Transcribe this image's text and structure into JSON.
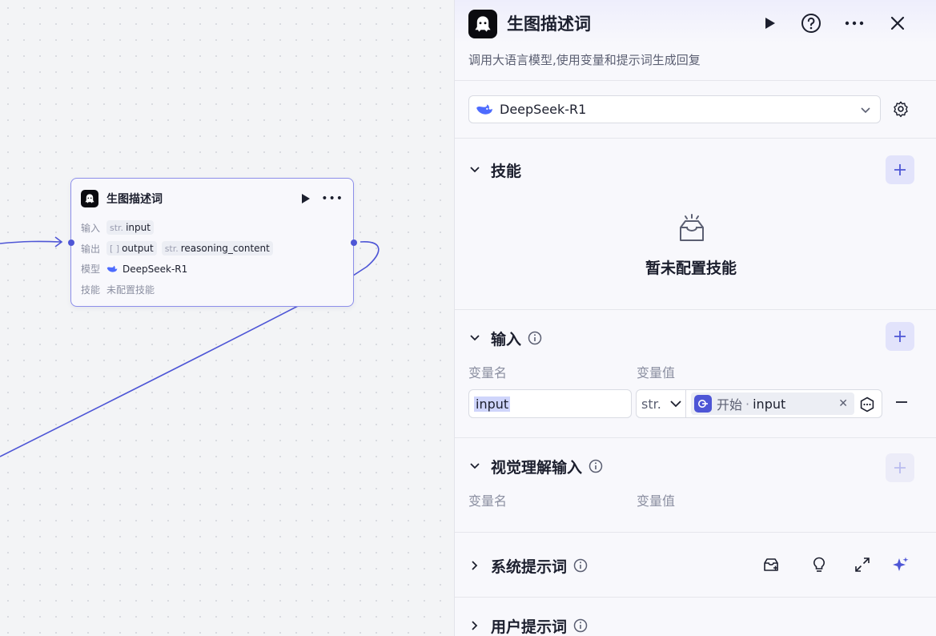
{
  "node": {
    "title": "生图描述词",
    "rows": {
      "input_label": "输入",
      "input_type": "str.",
      "input_value": "input",
      "output_label": "输出",
      "output_type_1": "[ ]",
      "output_value_1": "output",
      "output_type_2": "str.",
      "output_value_2": "reasoning_content",
      "model_label": "模型",
      "model_value": "DeepSeek-R1",
      "skill_label": "技能",
      "skill_value": "未配置技能"
    }
  },
  "panel": {
    "title": "生图描述词",
    "description": "调用大语言模型,使用变量和提示词生成回复",
    "model": {
      "name": "DeepSeek-R1"
    },
    "skills": {
      "title": "技能",
      "empty_text": "暂未配置技能"
    },
    "input": {
      "title": "输入",
      "col_name": "变量名",
      "col_value": "变量值",
      "var_name": "input",
      "var_type": "str.",
      "ref_source": "开始",
      "ref_separator": "·",
      "ref_var": "input"
    },
    "vision_input": {
      "title": "视觉理解输入",
      "col_name": "变量名",
      "col_value": "变量值"
    },
    "system_prompt": {
      "title": "系统提示词"
    },
    "user_prompt": {
      "title": "用户提示词"
    }
  },
  "colors": {
    "accent": "#4e56d6",
    "accent_light": "#e2e3fb",
    "node_border": "#8d8fea",
    "text": "#1c1f2e",
    "muted": "#8b8fa1"
  },
  "icons": [
    "node-logo-icon",
    "run-icon",
    "more-icon",
    "help-icon",
    "close-icon",
    "deepseek-icon",
    "chevron-down-icon",
    "gear-icon",
    "chevron-right-icon",
    "plus-icon",
    "info-icon",
    "empty-box-icon",
    "start-node-icon",
    "clear-icon",
    "variable-pick-icon",
    "minus-icon",
    "library-icon",
    "bulb-icon",
    "expand-icon",
    "sparkle-icon"
  ]
}
